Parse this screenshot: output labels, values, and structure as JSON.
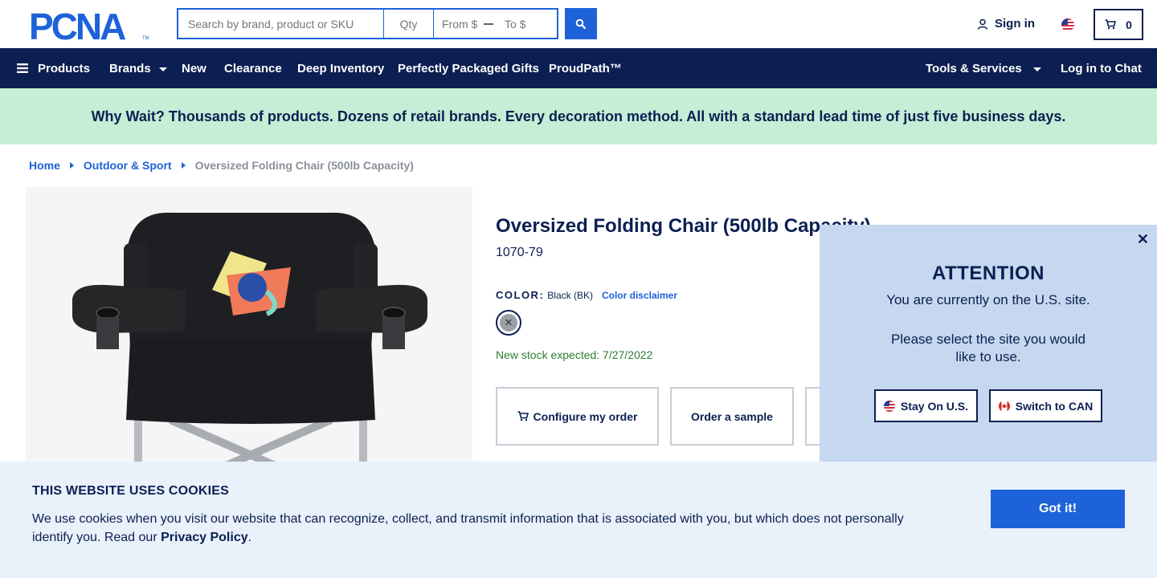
{
  "header": {
    "logo_text": "PCNA",
    "search_placeholder": "Search by brand, product or SKU",
    "qty_placeholder": "Qty",
    "price_from_placeholder": "From $",
    "price_to_placeholder": "To $",
    "signin_label": "Sign in",
    "cart_count": "0"
  },
  "nav": {
    "products": "Products",
    "brands": "Brands",
    "new": "New",
    "clearance": "Clearance",
    "deep_inventory": "Deep Inventory",
    "gifts": "Perfectly Packaged Gifts",
    "proudpath": "ProudPath™",
    "tools": "Tools & Services",
    "chat": "Log in to Chat"
  },
  "promo": {
    "text": "Why Wait? Thousands of products. Dozens of retail brands. Every decoration method. All with a standard lead time of just five business days."
  },
  "breadcrumb": {
    "home": "Home",
    "category": "Outdoor & Sport",
    "current": "Oversized Folding Chair (500lb Capacity)"
  },
  "product": {
    "title": "Oversized Folding Chair (500lb Capacity)",
    "sku": "1070-79",
    "color_label": "COLOR:",
    "color_value": "Black (BK)",
    "color_disclaimer": "Color disclaimer",
    "stock_text": "New stock expected: 7/27/2022",
    "configure_label": "Configure my order",
    "sample_label": "Order a sample"
  },
  "attention": {
    "title": "ATTENTION",
    "line1": "You are currently on the U.S. site.",
    "line2": "Please select the site you would",
    "line3": "like to use.",
    "stay_label": "Stay On U.S.",
    "switch_label": "Switch to CAN"
  },
  "cookie": {
    "title": "THIS WEBSITE USES COOKIES",
    "text_before": "We use cookies when you visit our website that can recognize, collect, and transmit information that is associated with you, but which does not personally identify you. Read our ",
    "link": "Privacy Policy",
    "text_after": ".",
    "button": "Got it!"
  },
  "colors": {
    "navy": "#0c1f52",
    "brand_blue": "#1d62d8",
    "promo_green": "#c4eed5",
    "popup_blue": "#c5d8ef",
    "cookie_bg": "#e9f1fa",
    "stock_green": "#2e7d32"
  }
}
